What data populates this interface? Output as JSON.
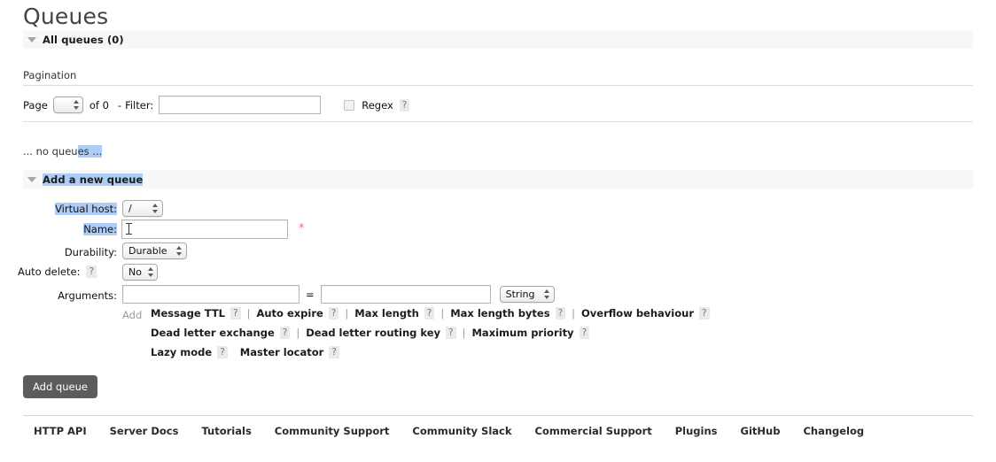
{
  "page": {
    "title": "Queues"
  },
  "all_queues": {
    "twisty": "triangle-down-icon",
    "label": "All queues (0)"
  },
  "pagination": {
    "heading": "Pagination",
    "page_label": "Page",
    "page_value": "",
    "of_label": "of 0",
    "dash": "-",
    "filter_label": "Filter:",
    "filter_value": "",
    "regex_label": "Regex",
    "regex_checked": false,
    "regex_help": "?"
  },
  "empty_state": {
    "text": "... no queues ..."
  },
  "add_queue_section": {
    "twisty": "triangle-down-icon",
    "label": "Add a new queue",
    "fields": {
      "virtual_host": {
        "label": "Virtual host:",
        "value": "/"
      },
      "name": {
        "label": "Name:",
        "value": "",
        "required_marker": "*"
      },
      "durability": {
        "label": "Durability:",
        "value": "Durable"
      },
      "auto_delete": {
        "label": "Auto delete:",
        "help": "?",
        "value": "No"
      },
      "arguments": {
        "label": "Arguments:",
        "key_value": "",
        "equals": "=",
        "val_value": "",
        "type_value": "String",
        "add_label": "Add"
      }
    },
    "argument_presets": [
      [
        {
          "label": "Message TTL",
          "help": "?"
        },
        {
          "label": "Auto expire",
          "help": "?"
        },
        {
          "label": "Max length",
          "help": "?"
        },
        {
          "label": "Max length bytes",
          "help": "?"
        },
        {
          "label": "Overflow behaviour",
          "help": "?"
        }
      ],
      [
        {
          "label": "Dead letter exchange",
          "help": "?"
        },
        {
          "label": "Dead letter routing key",
          "help": "?"
        },
        {
          "label": "Maximum priority",
          "help": "?"
        }
      ],
      [
        {
          "label": "Lazy mode",
          "help": "?"
        },
        {
          "label": "Master locator",
          "help": "?"
        }
      ]
    ],
    "submit_label": "Add queue"
  },
  "footer": {
    "links": [
      "HTTP API",
      "Server Docs",
      "Tutorials",
      "Community Support",
      "Community Slack",
      "Commercial Support",
      "Plugins",
      "GitHub",
      "Changelog"
    ]
  },
  "colors": {
    "selection": "#aecdf6",
    "band": "#f7f7f7",
    "button": "#5c5c5c",
    "required": "#f26d6d",
    "rule": "#dddddd"
  }
}
